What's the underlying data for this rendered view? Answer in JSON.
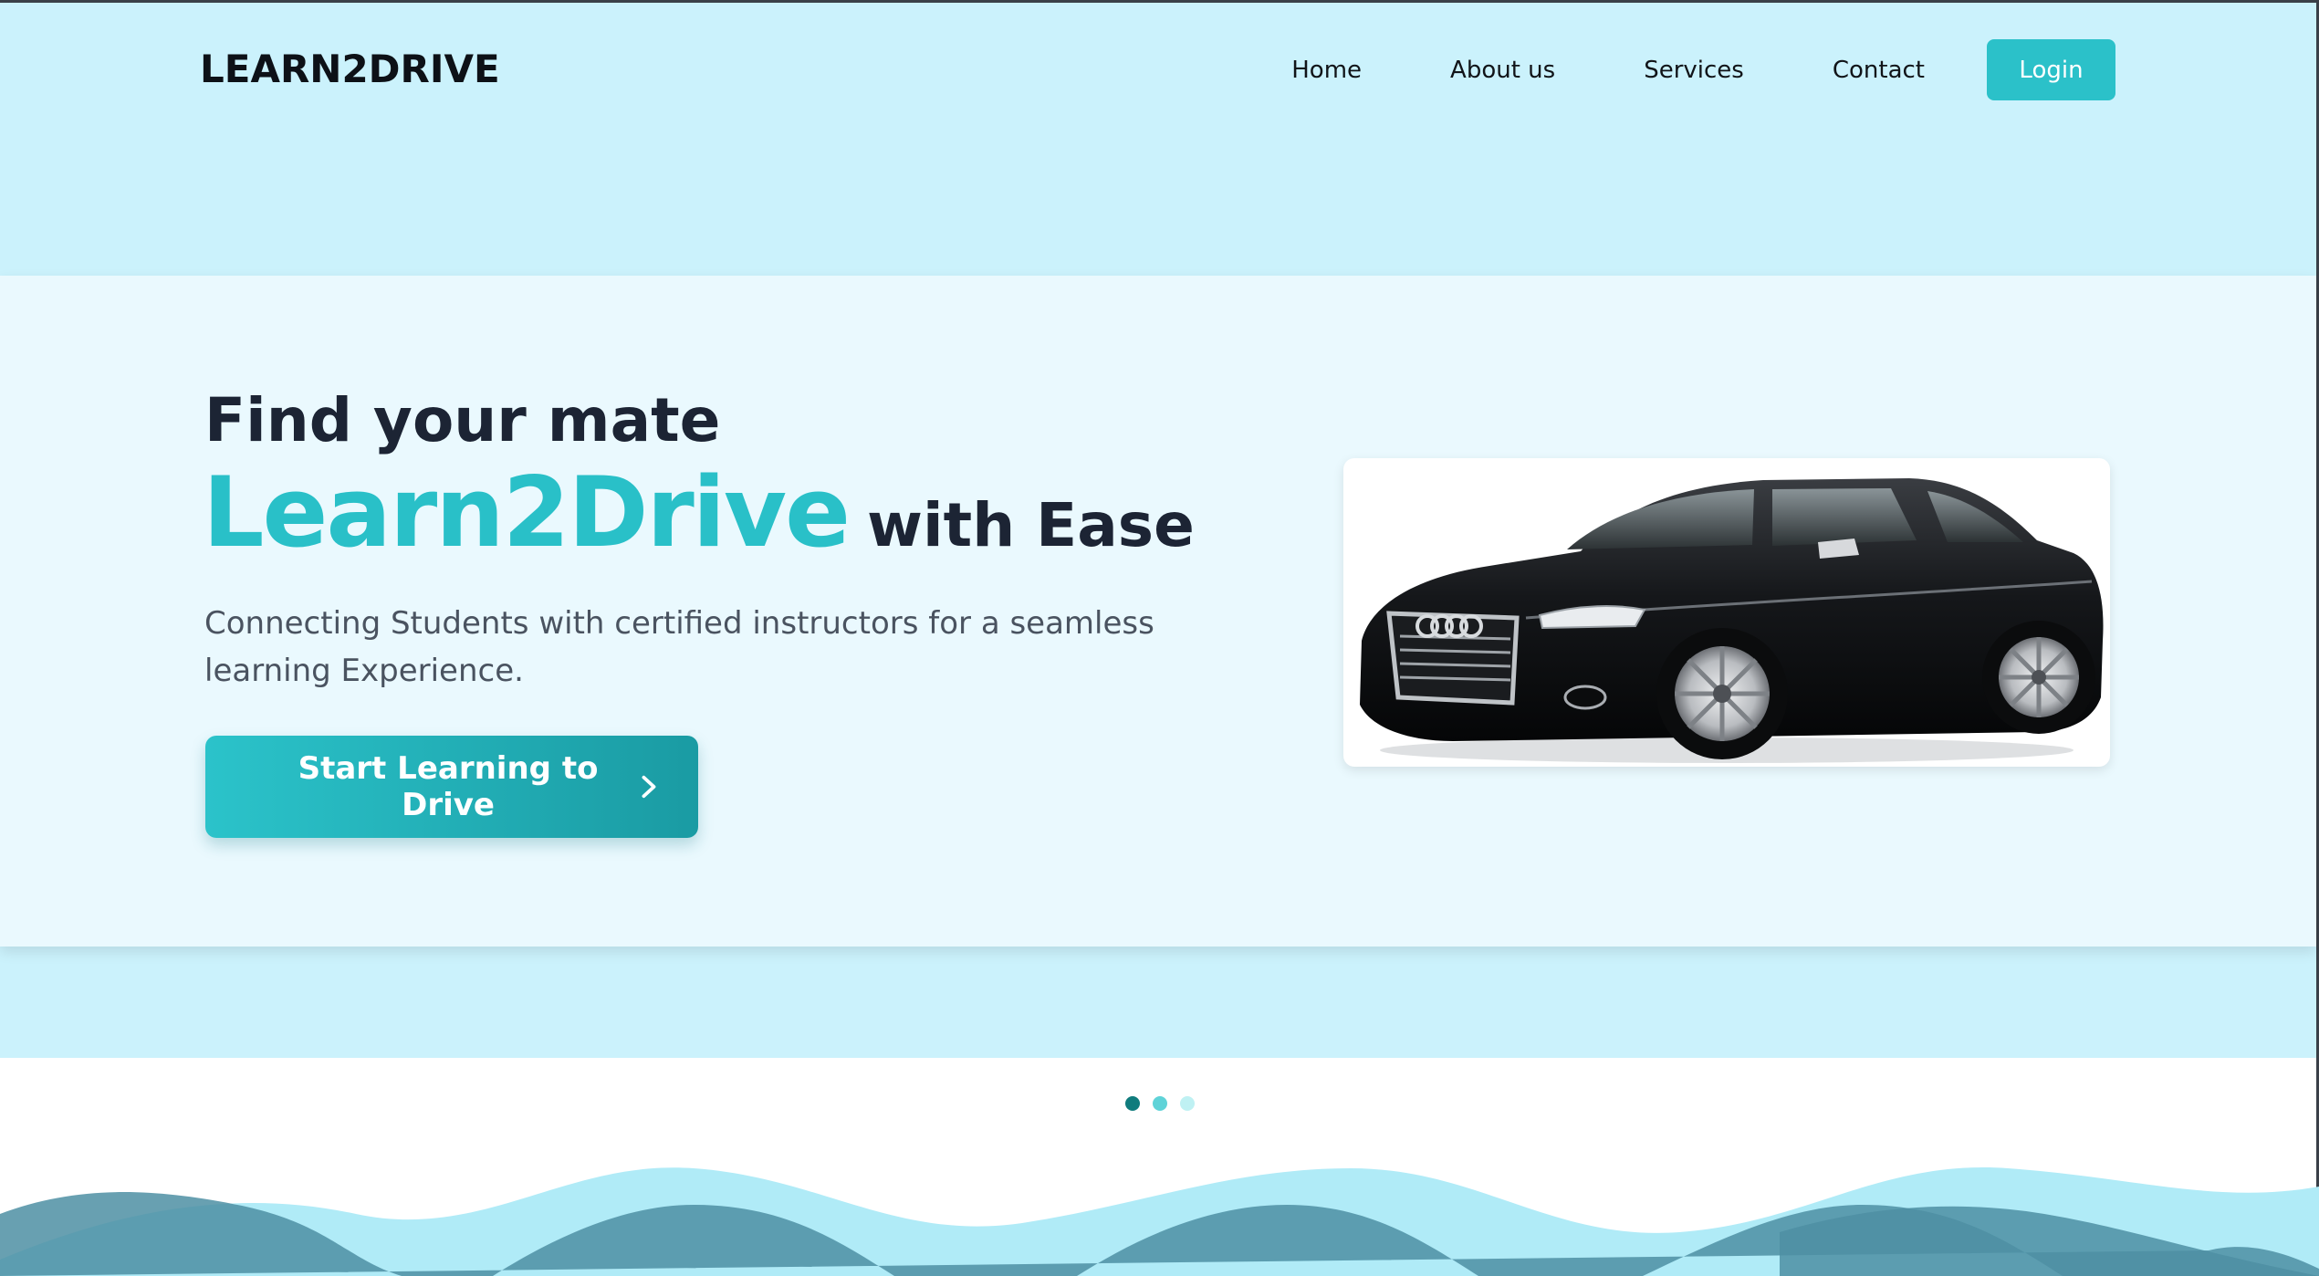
{
  "brand": {
    "logo_text": "LEARN2DRIVE"
  },
  "nav": {
    "links": [
      "Home",
      "About us",
      "Services",
      "Contact"
    ],
    "login_label": "Login"
  },
  "hero": {
    "eyebrow": "Find your mate",
    "brand_word": "Learn2Drive",
    "tagline_suffix": "with Ease",
    "subtitle": "Connecting Students with certified instructors for a seamless learning Experience.",
    "cta_label": "Start Learning to Drive",
    "image_icon": "car-photo"
  },
  "carousel": {
    "active_index": 0,
    "dot_colors": [
      "#107c7d",
      "#5fd3d8",
      "#bff1f3"
    ]
  },
  "colors": {
    "accent": "#2bc1c9",
    "hero_background": "#cbf2fc",
    "card_background": "#eaf9fe",
    "heading": "#1c2434",
    "wave_front": "#4e8fa3",
    "wave_back": "#b0ebf7"
  }
}
